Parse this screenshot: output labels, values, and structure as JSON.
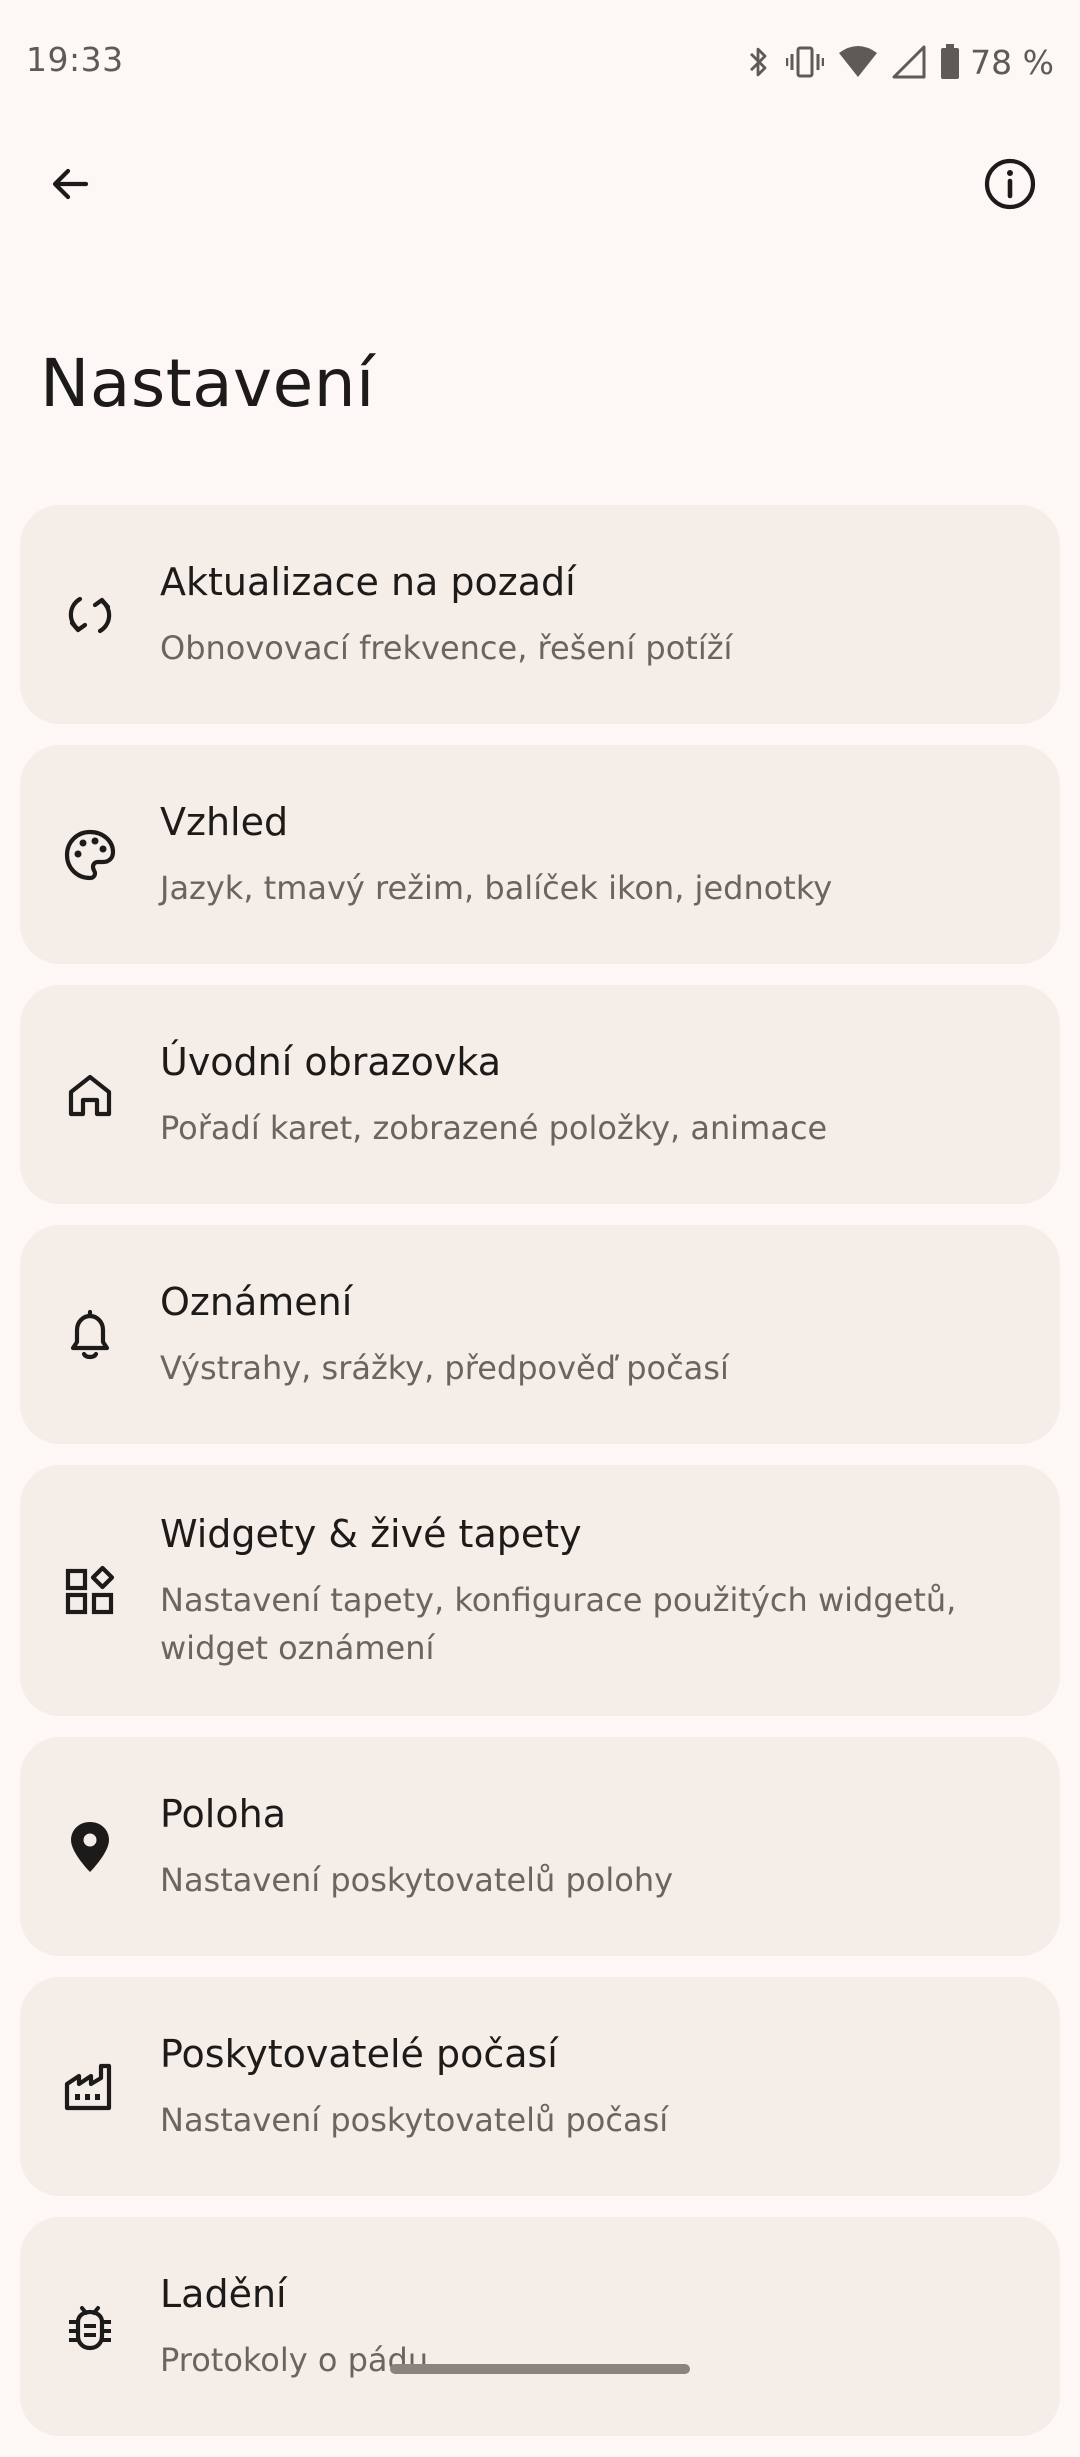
{
  "status_bar": {
    "time": "19:33",
    "battery": "78 %",
    "icons": [
      "bluetooth-icon",
      "vibrate-icon",
      "wifi-icon",
      "signal-icon",
      "battery-icon"
    ]
  },
  "top_bar": {
    "back_icon": "arrow-back-icon",
    "info_icon": "info-icon"
  },
  "page": {
    "title": "Nastavení"
  },
  "settings": [
    {
      "icon": "sync-icon",
      "title": "Aktualizace na pozadí",
      "subtitle": "Obnovovací frekvence, řešení potíží"
    },
    {
      "icon": "palette-icon",
      "title": "Vzhled",
      "subtitle": "Jazyk, tmavý režim, balíček ikon, jednotky"
    },
    {
      "icon": "home-icon",
      "title": "Úvodní obrazovka",
      "subtitle": "Pořadí karet, zobrazené položky, animace"
    },
    {
      "icon": "bell-icon",
      "title": "Oznámení",
      "subtitle": "Výstrahy, srážky, předpověď počasí"
    },
    {
      "icon": "widgets-icon",
      "title": "Widgety & živé tapety",
      "subtitle": "Nastavení tapety, konfigurace použitých widgetů, widget oznámení"
    },
    {
      "icon": "location-pin-icon",
      "title": "Poloha",
      "subtitle": "Nastavení poskytovatelů polohy"
    },
    {
      "icon": "factory-icon",
      "title": "Poskytovatelé počasí",
      "subtitle": "Nastavení poskytovatelů počasí"
    },
    {
      "icon": "bug-icon",
      "title": "Ladění",
      "subtitle": "Protokoly o pádu"
    }
  ]
}
